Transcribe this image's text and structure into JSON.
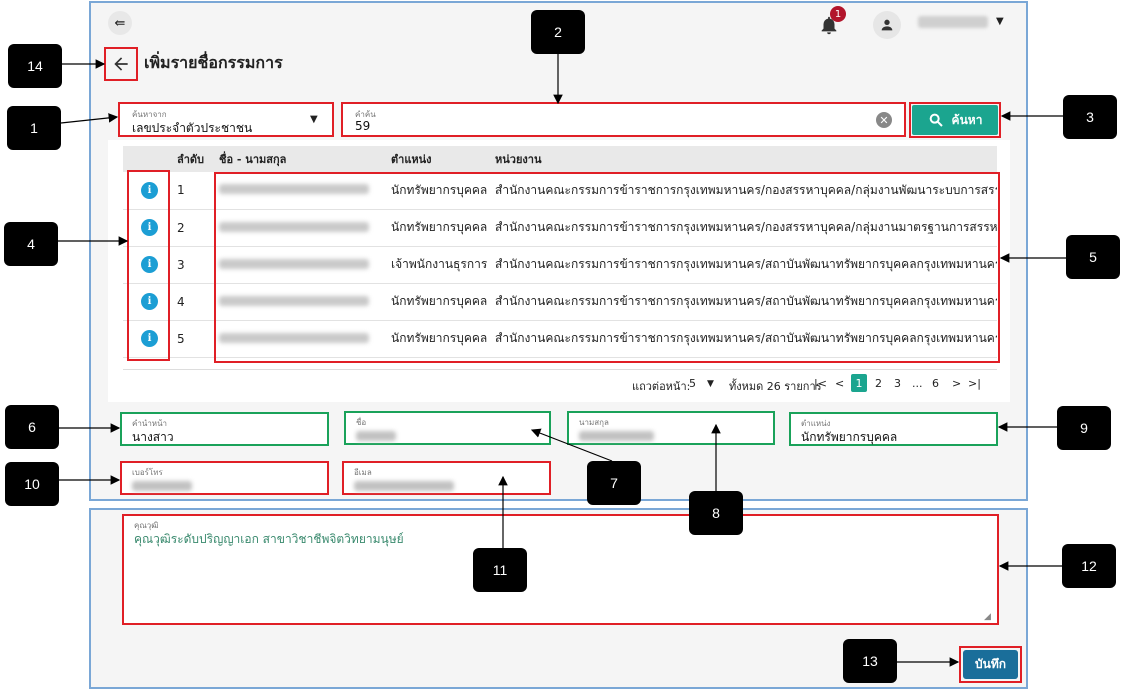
{
  "header": {
    "notification_count": "1",
    "menu_icon": "collapse-menu-icon"
  },
  "page": {
    "title": "เพิ่มรายชื่อกรรมการ"
  },
  "search": {
    "by_label": "ค้นหาจาก",
    "by_value": "เลขประจำตัวประชาชน",
    "keyword_label": "คำค้น",
    "keyword_value": "59",
    "button_label": "ค้นหา"
  },
  "table": {
    "headers": [
      "ลำดับ",
      "ชื่อ - นามสกุล",
      "ตำแหน่ง",
      "หน่วยงาน"
    ],
    "rows": [
      {
        "no": "1",
        "position": "นักทรัพยากรบุคคล",
        "unit": "สำนักงานคณะกรรมการข้าราชการกรุงเทพมหานคร/กองสรรหาบุคคล/กลุ่มงานพัฒนาระบบการสรรหา"
      },
      {
        "no": "2",
        "position": "นักทรัพยากรบุคคล",
        "unit": "สำนักงานคณะกรรมการข้าราชการกรุงเทพมหานคร/กองสรรหาบุคคล/กลุ่มงานมาตรฐานการสรรหา"
      },
      {
        "no": "3",
        "position": "เจ้าพนักงานธุรการ",
        "unit": "สำนักงานคณะกรรมการข้าราชการกรุงเทพมหานคร/สถาบันพัฒนาทรัพยากรบุคคลกรุงเทพมหานคร/ฝ่ายบ"
      },
      {
        "no": "4",
        "position": "นักทรัพยากรบุคคล",
        "unit": "สำนักงานคณะกรรมการข้าราชการกรุงเทพมหานคร/สถาบันพัฒนาทรัพยากรบุคคลกรุงเทพมหานคร/ส่วนส่"
      },
      {
        "no": "5",
        "position": "นักทรัพยากรบุคคล",
        "unit": "สำนักงานคณะกรรมการข้าราชการกรุงเทพมหานคร/สถาบันพัฒนาทรัพยากรบุคคลกรุงเทพมหานคร/ส่วนส่"
      }
    ]
  },
  "pager": {
    "rows_per_page_label": "แถวต่อหน้า:",
    "rows_per_page_value": "5",
    "total_label": "ทั้งหมด 26 รายการ",
    "pages": [
      "1",
      "2",
      "3",
      "...",
      "6"
    ],
    "current": "1"
  },
  "form": {
    "prefix_label": "คำนำหน้า",
    "prefix_value": "นางสาว",
    "firstname_label": "ชื่อ",
    "lastname_label": "นามสกุล",
    "position_label": "ตำแหน่ง",
    "position_value": "นักทรัพยากรบุคคล",
    "phone_label": "เบอร์โทร",
    "email_label": "อีเมล",
    "qualification_label": "คุณวุฒิ",
    "qualification_value": "คุณวุฒิระดับปริญญาเอก สาขาวิชาชีพจิตวิทยามนุษย์",
    "save_label": "บันทึก"
  },
  "callouts": [
    "1",
    "2",
    "3",
    "4",
    "5",
    "6",
    "7",
    "8",
    "9",
    "10",
    "11",
    "12",
    "13",
    "14"
  ],
  "colors": {
    "accent": "#1ba58f",
    "save": "#1a6e9a",
    "highlight_red": "#e01f26",
    "highlight_green": "#1aa25a",
    "frame": "#7aa7d6"
  }
}
